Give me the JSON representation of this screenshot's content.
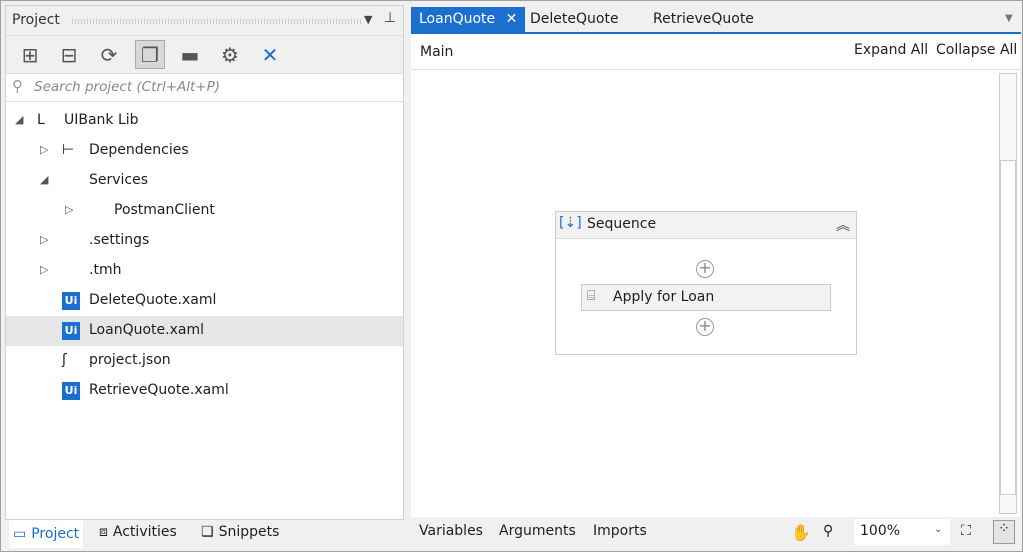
{
  "project_panel": {
    "title": "Project",
    "search_placeholder": "Search project (Ctrl+Alt+P)",
    "toolbar": [
      "expand-all",
      "collapse-all",
      "refresh",
      "show-all-files",
      "open-folder",
      "settings",
      "remove-unused"
    ],
    "tree": [
      {
        "label": "UIBank Lib",
        "level": 0,
        "arrow": "◢",
        "icon": "library-icon"
      },
      {
        "label": "Dependencies",
        "level": 1,
        "arrow": "▷",
        "icon": "dependencies-icon"
      },
      {
        "label": "Services",
        "level": 1,
        "arrow": "◢",
        "icon": "services-icon"
      },
      {
        "label": "PostmanClient",
        "level": 2,
        "arrow": "▷",
        "icon": "service-icon"
      },
      {
        "label": ".settings",
        "level": 1,
        "arrow": "▷",
        "icon": "folder-icon"
      },
      {
        "label": ".tmh",
        "level": 1,
        "arrow": "▷",
        "icon": "folder-icon"
      },
      {
        "label": "DeleteQuote.xaml",
        "level": 1,
        "arrow": "",
        "icon": "xaml-icon"
      },
      {
        "label": "LoanQuote.xaml",
        "level": 1,
        "arrow": "",
        "icon": "xaml-icon",
        "selected": true
      },
      {
        "label": "project.json",
        "level": 1,
        "arrow": "",
        "icon": "json-icon"
      },
      {
        "label": "RetrieveQuote.xaml",
        "level": 1,
        "arrow": "",
        "icon": "xaml-icon"
      }
    ],
    "bottom_tabs": [
      "Project",
      "Activities",
      "Snippets"
    ]
  },
  "editor": {
    "tabs": [
      "LoanQuote",
      "DeleteQuote",
      "RetrieveQuote"
    ],
    "breadcrumb": "Main",
    "expand_all": "Expand All",
    "collapse_all": "Collapse All",
    "sequence": {
      "title": "Sequence",
      "activity": "Apply for Loan"
    },
    "bottom": {
      "variables": "Variables",
      "arguments": "Arguments",
      "imports": "Imports",
      "zoom": "100%"
    }
  },
  "colors": {
    "accent": "#1a6fcf"
  }
}
